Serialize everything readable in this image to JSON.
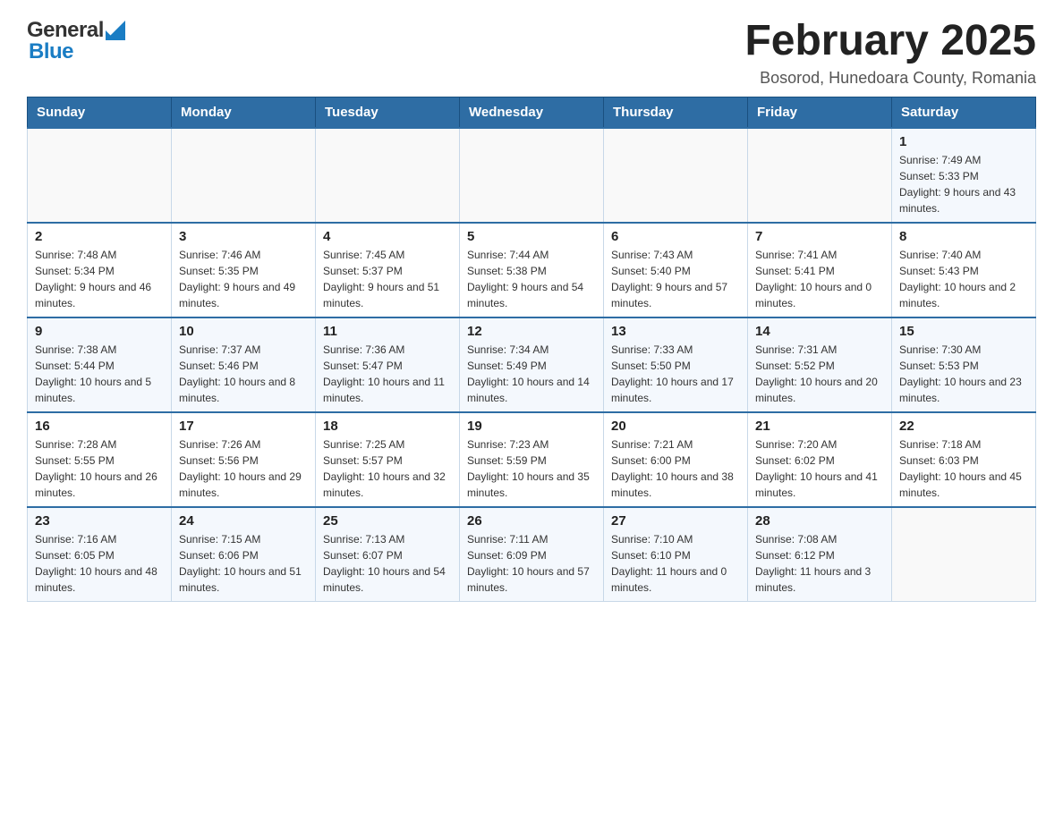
{
  "header": {
    "logo_general": "General",
    "logo_blue": "Blue",
    "title": "February 2025",
    "subtitle": "Bosorod, Hunedoara County, Romania"
  },
  "days_of_week": [
    "Sunday",
    "Monday",
    "Tuesday",
    "Wednesday",
    "Thursday",
    "Friday",
    "Saturday"
  ],
  "weeks": [
    [
      {
        "day": "",
        "sunrise": "",
        "sunset": "",
        "daylight": ""
      },
      {
        "day": "",
        "sunrise": "",
        "sunset": "",
        "daylight": ""
      },
      {
        "day": "",
        "sunrise": "",
        "sunset": "",
        "daylight": ""
      },
      {
        "day": "",
        "sunrise": "",
        "sunset": "",
        "daylight": ""
      },
      {
        "day": "",
        "sunrise": "",
        "sunset": "",
        "daylight": ""
      },
      {
        "day": "",
        "sunrise": "",
        "sunset": "",
        "daylight": ""
      },
      {
        "day": "1",
        "sunrise": "Sunrise: 7:49 AM",
        "sunset": "Sunset: 5:33 PM",
        "daylight": "Daylight: 9 hours and 43 minutes."
      }
    ],
    [
      {
        "day": "2",
        "sunrise": "Sunrise: 7:48 AM",
        "sunset": "Sunset: 5:34 PM",
        "daylight": "Daylight: 9 hours and 46 minutes."
      },
      {
        "day": "3",
        "sunrise": "Sunrise: 7:46 AM",
        "sunset": "Sunset: 5:35 PM",
        "daylight": "Daylight: 9 hours and 49 minutes."
      },
      {
        "day": "4",
        "sunrise": "Sunrise: 7:45 AM",
        "sunset": "Sunset: 5:37 PM",
        "daylight": "Daylight: 9 hours and 51 minutes."
      },
      {
        "day": "5",
        "sunrise": "Sunrise: 7:44 AM",
        "sunset": "Sunset: 5:38 PM",
        "daylight": "Daylight: 9 hours and 54 minutes."
      },
      {
        "day": "6",
        "sunrise": "Sunrise: 7:43 AM",
        "sunset": "Sunset: 5:40 PM",
        "daylight": "Daylight: 9 hours and 57 minutes."
      },
      {
        "day": "7",
        "sunrise": "Sunrise: 7:41 AM",
        "sunset": "Sunset: 5:41 PM",
        "daylight": "Daylight: 10 hours and 0 minutes."
      },
      {
        "day": "8",
        "sunrise": "Sunrise: 7:40 AM",
        "sunset": "Sunset: 5:43 PM",
        "daylight": "Daylight: 10 hours and 2 minutes."
      }
    ],
    [
      {
        "day": "9",
        "sunrise": "Sunrise: 7:38 AM",
        "sunset": "Sunset: 5:44 PM",
        "daylight": "Daylight: 10 hours and 5 minutes."
      },
      {
        "day": "10",
        "sunrise": "Sunrise: 7:37 AM",
        "sunset": "Sunset: 5:46 PM",
        "daylight": "Daylight: 10 hours and 8 minutes."
      },
      {
        "day": "11",
        "sunrise": "Sunrise: 7:36 AM",
        "sunset": "Sunset: 5:47 PM",
        "daylight": "Daylight: 10 hours and 11 minutes."
      },
      {
        "day": "12",
        "sunrise": "Sunrise: 7:34 AM",
        "sunset": "Sunset: 5:49 PM",
        "daylight": "Daylight: 10 hours and 14 minutes."
      },
      {
        "day": "13",
        "sunrise": "Sunrise: 7:33 AM",
        "sunset": "Sunset: 5:50 PM",
        "daylight": "Daylight: 10 hours and 17 minutes."
      },
      {
        "day": "14",
        "sunrise": "Sunrise: 7:31 AM",
        "sunset": "Sunset: 5:52 PM",
        "daylight": "Daylight: 10 hours and 20 minutes."
      },
      {
        "day": "15",
        "sunrise": "Sunrise: 7:30 AM",
        "sunset": "Sunset: 5:53 PM",
        "daylight": "Daylight: 10 hours and 23 minutes."
      }
    ],
    [
      {
        "day": "16",
        "sunrise": "Sunrise: 7:28 AM",
        "sunset": "Sunset: 5:55 PM",
        "daylight": "Daylight: 10 hours and 26 minutes."
      },
      {
        "day": "17",
        "sunrise": "Sunrise: 7:26 AM",
        "sunset": "Sunset: 5:56 PM",
        "daylight": "Daylight: 10 hours and 29 minutes."
      },
      {
        "day": "18",
        "sunrise": "Sunrise: 7:25 AM",
        "sunset": "Sunset: 5:57 PM",
        "daylight": "Daylight: 10 hours and 32 minutes."
      },
      {
        "day": "19",
        "sunrise": "Sunrise: 7:23 AM",
        "sunset": "Sunset: 5:59 PM",
        "daylight": "Daylight: 10 hours and 35 minutes."
      },
      {
        "day": "20",
        "sunrise": "Sunrise: 7:21 AM",
        "sunset": "Sunset: 6:00 PM",
        "daylight": "Daylight: 10 hours and 38 minutes."
      },
      {
        "day": "21",
        "sunrise": "Sunrise: 7:20 AM",
        "sunset": "Sunset: 6:02 PM",
        "daylight": "Daylight: 10 hours and 41 minutes."
      },
      {
        "day": "22",
        "sunrise": "Sunrise: 7:18 AM",
        "sunset": "Sunset: 6:03 PM",
        "daylight": "Daylight: 10 hours and 45 minutes."
      }
    ],
    [
      {
        "day": "23",
        "sunrise": "Sunrise: 7:16 AM",
        "sunset": "Sunset: 6:05 PM",
        "daylight": "Daylight: 10 hours and 48 minutes."
      },
      {
        "day": "24",
        "sunrise": "Sunrise: 7:15 AM",
        "sunset": "Sunset: 6:06 PM",
        "daylight": "Daylight: 10 hours and 51 minutes."
      },
      {
        "day": "25",
        "sunrise": "Sunrise: 7:13 AM",
        "sunset": "Sunset: 6:07 PM",
        "daylight": "Daylight: 10 hours and 54 minutes."
      },
      {
        "day": "26",
        "sunrise": "Sunrise: 7:11 AM",
        "sunset": "Sunset: 6:09 PM",
        "daylight": "Daylight: 10 hours and 57 minutes."
      },
      {
        "day": "27",
        "sunrise": "Sunrise: 7:10 AM",
        "sunset": "Sunset: 6:10 PM",
        "daylight": "Daylight: 11 hours and 0 minutes."
      },
      {
        "day": "28",
        "sunrise": "Sunrise: 7:08 AM",
        "sunset": "Sunset: 6:12 PM",
        "daylight": "Daylight: 11 hours and 3 minutes."
      },
      {
        "day": "",
        "sunrise": "",
        "sunset": "",
        "daylight": ""
      }
    ]
  ]
}
